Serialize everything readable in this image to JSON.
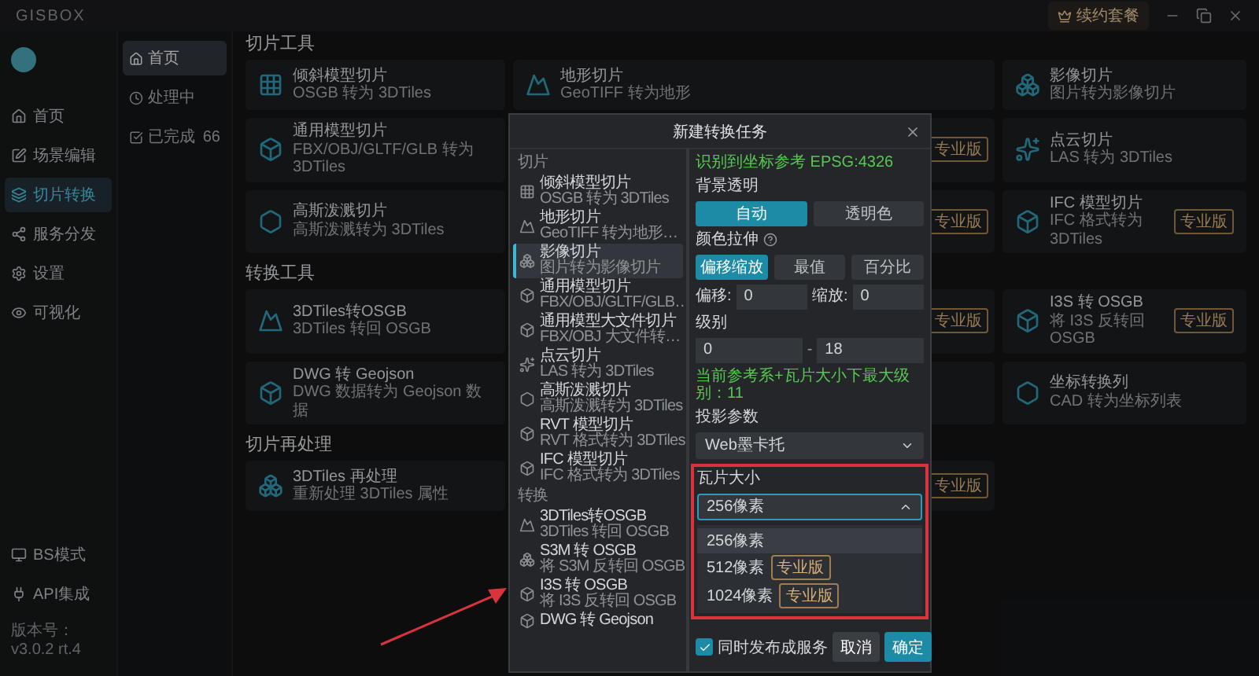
{
  "app": {
    "logo": "GISBOX",
    "plan_button": "续约套餐"
  },
  "nav": {
    "items": [
      {
        "label": "首页",
        "selected": false
      },
      {
        "label": "场景编辑",
        "selected": false
      },
      {
        "label": "切片转换",
        "selected": true
      },
      {
        "label": "服务分发",
        "selected": false
      },
      {
        "label": "设置",
        "selected": false
      },
      {
        "label": "可视化",
        "selected": false
      }
    ],
    "bottom": [
      {
        "label": "BS模式"
      },
      {
        "label": "API集成"
      }
    ],
    "version": "版本号：v3.0.2 rt.4"
  },
  "subnav": [
    {
      "label": "首页",
      "selected": true
    },
    {
      "label": "处理中",
      "selected": false
    },
    {
      "label": "已完成",
      "count": "66",
      "selected": false
    }
  ],
  "sections": [
    {
      "title": "切片工具",
      "cards": [
        {
          "kind": "tool",
          "title": "倾斜模型切片",
          "subtitle": "OSGB 转为 3DTiles"
        },
        {
          "kind": "tool",
          "title": "地形切片",
          "subtitle": "GeoTIFF 转为地形"
        },
        {
          "kind": "tool",
          "title": "影像切片",
          "subtitle": "图片转为影像切片"
        },
        {
          "kind": "tool",
          "title": "通用模型切片",
          "subtitle": "FBX/OBJ/GLTF/GLB 转为 3DTiles"
        },
        {
          "kind": "covered",
          "badge": "专业版"
        },
        {
          "kind": "tool",
          "title": "点云切片",
          "subtitle": "LAS 转为 3DTiles"
        },
        {
          "kind": "tool",
          "title": "高斯泼溅切片",
          "subtitle": "高斯泼溅转为 3DTiles"
        },
        {
          "kind": "covered",
          "badge": "专业版"
        },
        {
          "kind": "tool",
          "title": "IFC 模型切片",
          "subtitle": "IFC 格式转为 3DTiles",
          "badge": "专业版"
        }
      ]
    },
    {
      "title": "转换工具",
      "cards": [
        {
          "kind": "tool",
          "title": "3DTiles转OSGB",
          "subtitle": "3DTiles 转回 OSGB"
        },
        {
          "kind": "covered",
          "badge": "专业版"
        },
        {
          "kind": "tool",
          "title": "I3S 转 OSGB",
          "subtitle": "将 I3S 反转回 OSGB",
          "badge": "专业版"
        },
        {
          "kind": "tool",
          "title": "DWG 转 Geojson",
          "subtitle": "DWG 数据转为 Geojson 数据"
        },
        {
          "kind": "covered"
        },
        {
          "kind": "tool",
          "title": "坐标转换列",
          "subtitle": "CAD 转为坐标列表"
        }
      ]
    },
    {
      "title": "切片再处理",
      "cards": [
        {
          "kind": "tool",
          "title": "3DTiles 再处理",
          "subtitle": "重新处理 3DTiles 属性"
        },
        {
          "kind": "covered",
          "badge": "专业版"
        }
      ]
    }
  ],
  "dialog": {
    "title": "新建转换任务",
    "list": [
      {
        "section": "切片",
        "items": [
          {
            "title": "倾斜模型切片",
            "subtitle": "OSGB 转为 3DTiles",
            "selected": false
          },
          {
            "title": "地形切片",
            "subtitle": "GeoTIFF 转为地形…",
            "selected": false
          },
          {
            "title": "影像切片",
            "subtitle": "图片转为影像切片",
            "selected": true
          },
          {
            "title": "通用模型切片",
            "subtitle": "FBX/OBJ/GLTF/GLB…",
            "selected": false
          },
          {
            "title": "通用模型大文件切片",
            "subtitle": "FBX/OBJ 大文件转…",
            "selected": false
          },
          {
            "title": "点云切片",
            "subtitle": "LAS 转为 3DTiles",
            "selected": false
          },
          {
            "title": "高斯泼溅切片",
            "subtitle": "高斯泼溅转为 3DTiles",
            "selected": false
          },
          {
            "title": "RVT 模型切片",
            "subtitle": "RVT 格式转为 3DTiles",
            "selected": false
          },
          {
            "title": "IFC 模型切片",
            "subtitle": "IFC 格式转为 3DTiles",
            "selected": false
          }
        ]
      },
      {
        "section": "转换",
        "items": [
          {
            "title": "3DTiles转OSGB",
            "subtitle": "3DTiles 转回 OSGB",
            "selected": false
          },
          {
            "title": "S3M 转 OSGB",
            "subtitle": "将 S3M 反转回 OSGB",
            "selected": false
          },
          {
            "title": "I3S 转 OSGB",
            "subtitle": "将 I3S 反转回 OSGB",
            "selected": false
          },
          {
            "title": "DWG 转 Geojson",
            "selected": false
          }
        ]
      }
    ],
    "crs_note": "识别到坐标参考 EPSG:4326",
    "background": {
      "label": "背景透明",
      "options": [
        {
          "label": "自动",
          "selected": true
        },
        {
          "label": "透明色",
          "selected": false
        }
      ]
    },
    "stretch": {
      "label": "颜色拉伸",
      "options": [
        {
          "label": "偏移缩放",
          "selected": true
        },
        {
          "label": "最值",
          "selected": false
        },
        {
          "label": "百分比",
          "selected": false
        }
      ]
    },
    "offset": {
      "label": "偏移:",
      "value": "0"
    },
    "scale": {
      "label": "缩放:",
      "value": "0"
    },
    "level": {
      "label": "级别",
      "min": "0",
      "separator": "-",
      "max": "18"
    },
    "level_note": "当前参考系+瓦片大小下最大级别：11",
    "projection": {
      "label": "投影参数",
      "value": "Web墨卡托"
    },
    "tile_size": {
      "label": "瓦片大小",
      "value": "256像素",
      "expanded": true,
      "options": [
        {
          "label": "256像素",
          "selected": true
        },
        {
          "label": "512像素",
          "badge": "专业版",
          "selected": false
        },
        {
          "label": "1024像素",
          "badge": "专业版",
          "selected": false
        }
      ]
    },
    "publish": {
      "label": "同时发布成服务",
      "checked": true
    },
    "buttons": [
      {
        "label": "取消",
        "kind": "secondary"
      },
      {
        "label": "确定",
        "kind": "primary"
      }
    ]
  }
}
